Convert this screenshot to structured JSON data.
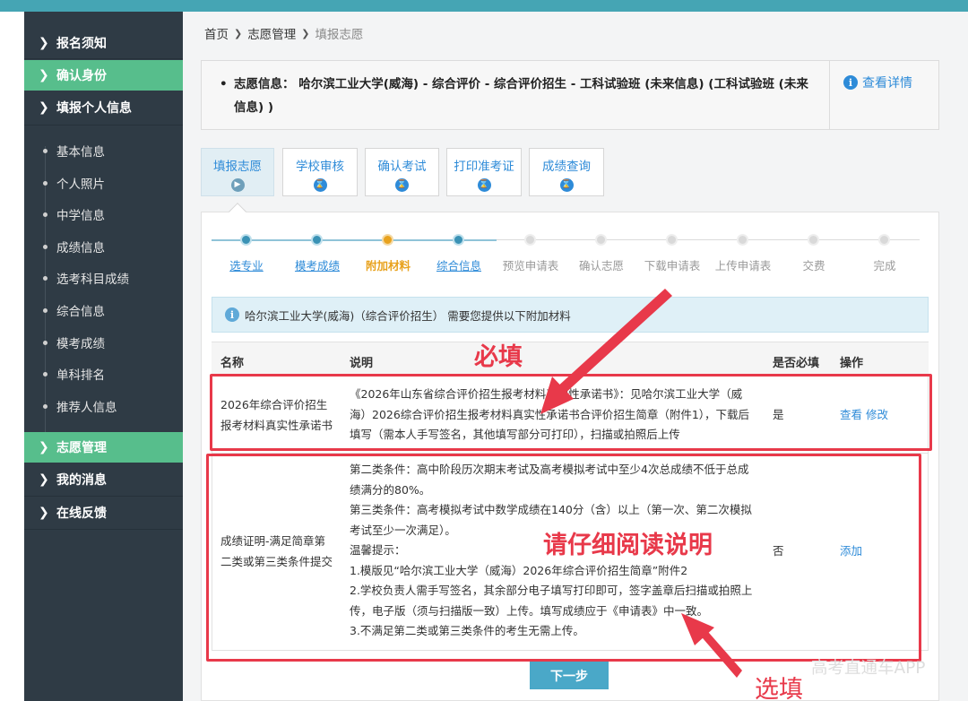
{
  "sidebar": {
    "top_items": [
      {
        "label": "报名须知"
      },
      {
        "label": "确认身份"
      },
      {
        "label": "填报个人信息"
      }
    ],
    "sub_items": [
      "基本信息",
      "个人照片",
      "中学信息",
      "成绩信息",
      "选考科目成绩",
      "综合信息",
      "模考成绩",
      "单科排名",
      "推荐人信息"
    ],
    "bottom_items": [
      {
        "label": "志愿管理"
      },
      {
        "label": "我的消息"
      },
      {
        "label": "在线反馈"
      }
    ]
  },
  "breadcrumb": {
    "home": "首页",
    "section": "志愿管理",
    "current": "填报志愿"
  },
  "info": {
    "text": "志愿信息： 哈尔滨工业大学(威海) - 综合评价 - 综合评价招生 - 工科试验班 (未来信息) (工科试验班 (未来信息) )",
    "detail_link": "查看详情"
  },
  "tabs": [
    "填报志愿",
    "学校审核",
    "确认考试",
    "打印准考证",
    "成绩查询"
  ],
  "steps": [
    "选专业",
    "模考成绩",
    "附加材料",
    "综合信息",
    "预览申请表",
    "确认志愿",
    "下载申请表",
    "上传申请表",
    "交费",
    "完成"
  ],
  "notice": "哈尔滨工业大学(威海)（综合评价招生） 需要您提供以下附加材料",
  "table": {
    "headers": {
      "name": "名称",
      "desc": "说明",
      "required": "是否必填",
      "action": "操作"
    },
    "rows": [
      {
        "name_l1": "2026年综合评价招生",
        "name_l2": "报考材料真实性承诺书",
        "desc_l1": "《2026年山东省综合评价招生报考材料真实性承诺书》：见哈尔滨工业大学（威",
        "desc_l2": "海）2026综合评价招生报考材料真实性承诺书合评价招生简章（附件1），下载后",
        "desc_l3": "填写（需本人手写签名，其他填写部分可打印），扫描或拍照后上传",
        "required": "是",
        "action_view": "查看",
        "action_edit": "修改"
      },
      {
        "name_l1": "成绩证明-满足简章第",
        "name_l2": "二类或第三类条件提交",
        "desc_lines": [
          "第二类条件：高中阶段历次期末考试及高考模拟考试中至少4次总成绩不低于总成",
          "绩满分的80%。",
          "第三类条件：高考模拟考试中数学成绩在140分（含）以上（第一次、第二次模拟",
          "考试至少一次满足）。",
          "温馨提示：",
          "1.模版见“哈尔滨工业大学（威海）2026年综合评价招生简章”附件2",
          "2.学校负责人需手写签名，其余部分电子填写打印即可，签字盖章后扫描或拍照上",
          "传，电子版（须与扫描版一致）上传。填写成绩应于《申请表》中一致。",
          "3.不满足第二类或第三类条件的考生无需上传。"
        ],
        "required": "否",
        "action_add": "添加"
      }
    ]
  },
  "annotations": {
    "required": "必填",
    "read_carefully": "请仔细阅读说明",
    "optional": "选填"
  },
  "next_button": "下一步",
  "watermark": "高考直通车APP",
  "colors": {
    "accent": "#2e8bd8",
    "sidebar": "#2f3b45",
    "active_green": "#57be8c",
    "annotation_red": "#e8394a",
    "top_bar": "#45a5b4"
  }
}
